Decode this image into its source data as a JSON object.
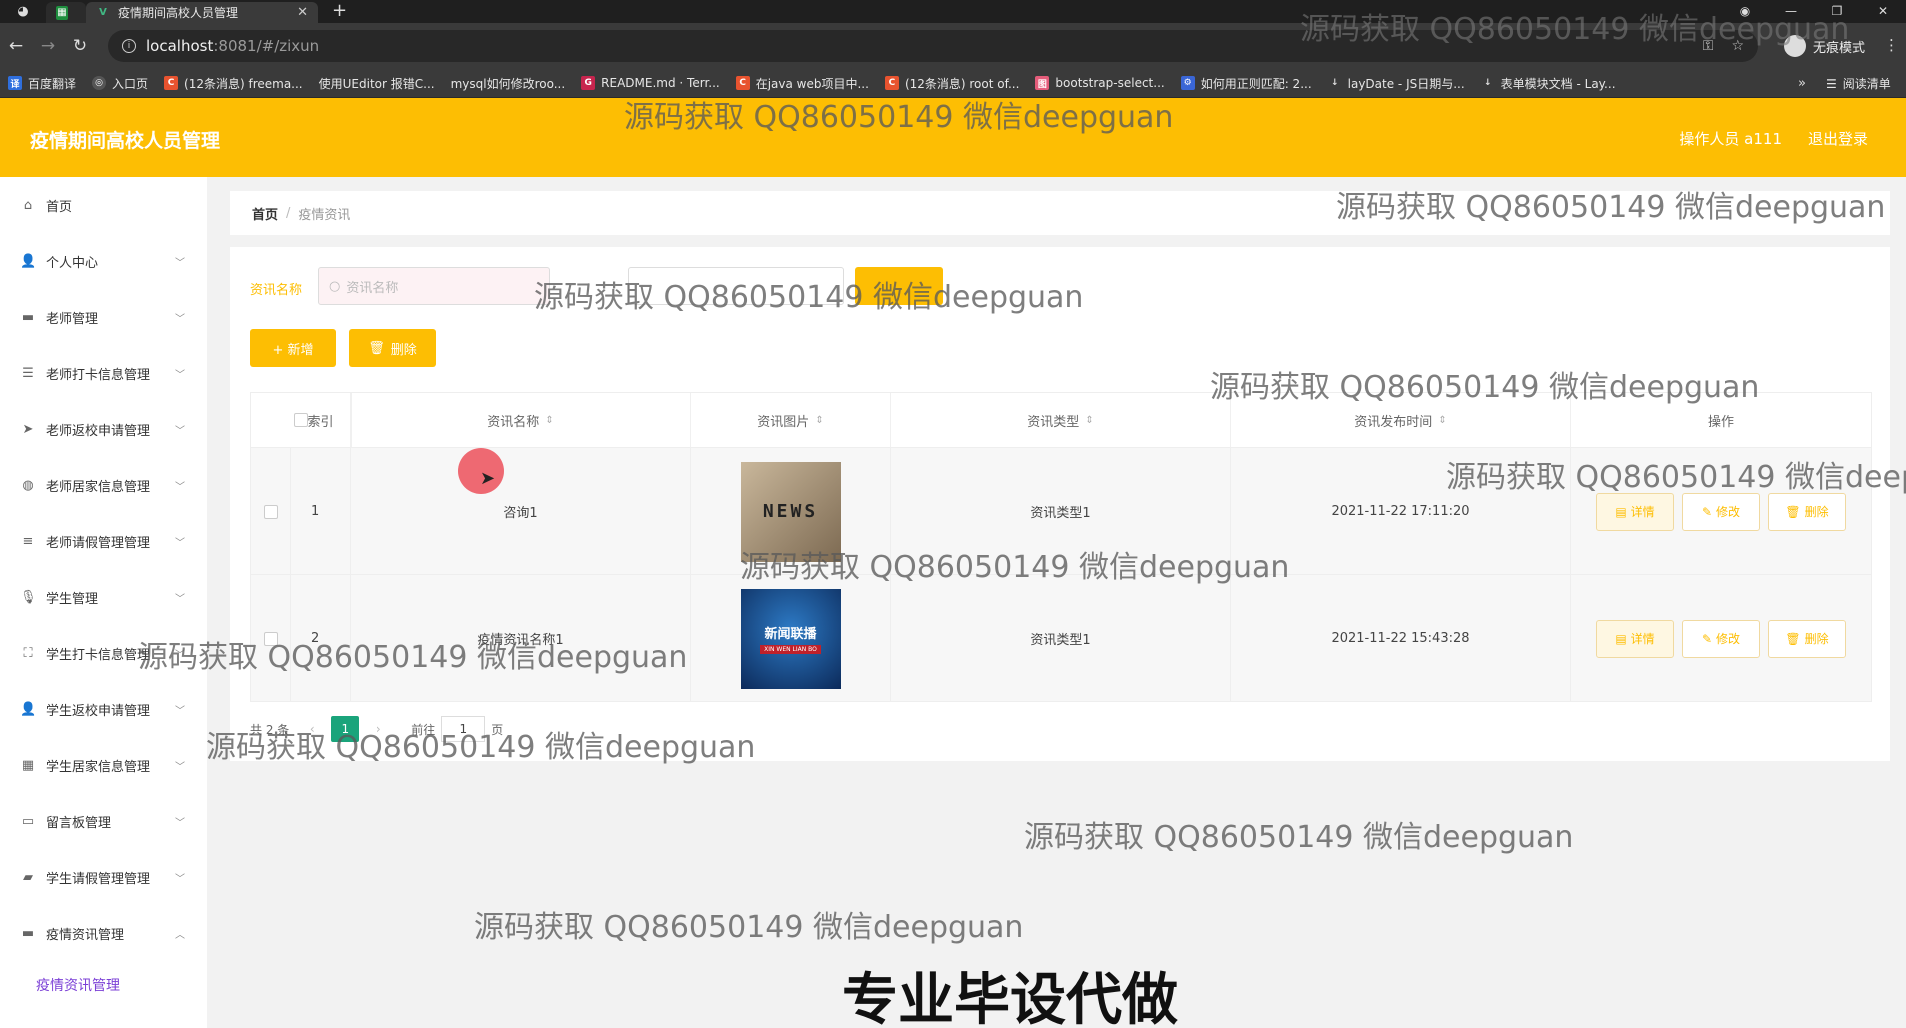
{
  "browser": {
    "tab_title": "疫情期间高校人员管理",
    "url_host": "localhost",
    "url_path": ":8081/#/zixun",
    "incognito_label": "无痕模式",
    "bookmarks": [
      "百度翻译",
      "入口页",
      "(12条消息) freema...",
      "使用UEditor 报错C...",
      "mysql如何修改roo...",
      "README.md · Terr...",
      "在java web项目中...",
      "(12条消息) root of...",
      "bootstrap-select...",
      "如何用正则匹配: 2...",
      "layDate - JS日期与...",
      "表单模块文档 - Lay..."
    ],
    "reading_list": "阅读清单"
  },
  "header": {
    "title": "疫情期间高校人员管理",
    "operator": "操作人员 a111",
    "logout": "退出登录"
  },
  "sidebar": {
    "items": [
      {
        "label": "首页",
        "icon": "home-icon"
      },
      {
        "label": "个人中心",
        "icon": "user-icon"
      },
      {
        "label": "老师管理",
        "icon": "folder-icon"
      },
      {
        "label": "老师打卡信息管理",
        "icon": "sliders-icon"
      },
      {
        "label": "老师返校申请管理",
        "icon": "send-icon"
      },
      {
        "label": "老师居家信息管理",
        "icon": "globe-icon"
      },
      {
        "label": "老师请假管理管理",
        "icon": "list-icon"
      },
      {
        "label": "学生管理",
        "icon": "mic-icon"
      },
      {
        "label": "学生打卡信息管理",
        "icon": "frame-icon"
      },
      {
        "label": "学生返校申请管理",
        "icon": "user-icon"
      },
      {
        "label": "学生居家信息管理",
        "icon": "grid-icon"
      },
      {
        "label": "留言板管理",
        "icon": "message-icon"
      },
      {
        "label": "学生请假管理管理",
        "icon": "briefcase-icon"
      },
      {
        "label": "疫情资讯管理",
        "icon": "folder-icon"
      }
    ],
    "active_sub": "疫情资讯管理"
  },
  "breadcrumb": {
    "home": "首页",
    "current": "疫情资讯"
  },
  "filters": {
    "name_label": "资讯名称",
    "name_placeholder": "资讯名称"
  },
  "actions": {
    "add": "+ 新增",
    "delete": "删除"
  },
  "table": {
    "columns": [
      "索引",
      "资讯名称",
      "资讯图片",
      "资讯类型",
      "资讯发布时间",
      "操作"
    ],
    "rows": [
      {
        "index": "1",
        "name": "咨询1",
        "type": "资讯类型1",
        "time": "2021-11-22 17:11:20",
        "image_text": "NEWS"
      },
      {
        "index": "2",
        "name": "疫情资讯名称1",
        "type": "资讯类型1",
        "time": "2021-11-22 15:43:28",
        "image_text": "新闻联播",
        "image_sub": "XIN WEN LIAN BO"
      }
    ],
    "op_detail": "详情",
    "op_edit": "修改",
    "op_delete": "删除"
  },
  "pager": {
    "total": "共 2 条",
    "page": "1",
    "goto": "前往",
    "goto_value": "1",
    "page_suffix": "页"
  },
  "overlay": {
    "watermark": "源码获取 QQ86050149 微信deepguan",
    "banner": "专业毕设代做"
  },
  "colors": {
    "accent": "#fdbe03",
    "pager_active": "#1aa47b",
    "sub_active": "#7b3fd6"
  }
}
